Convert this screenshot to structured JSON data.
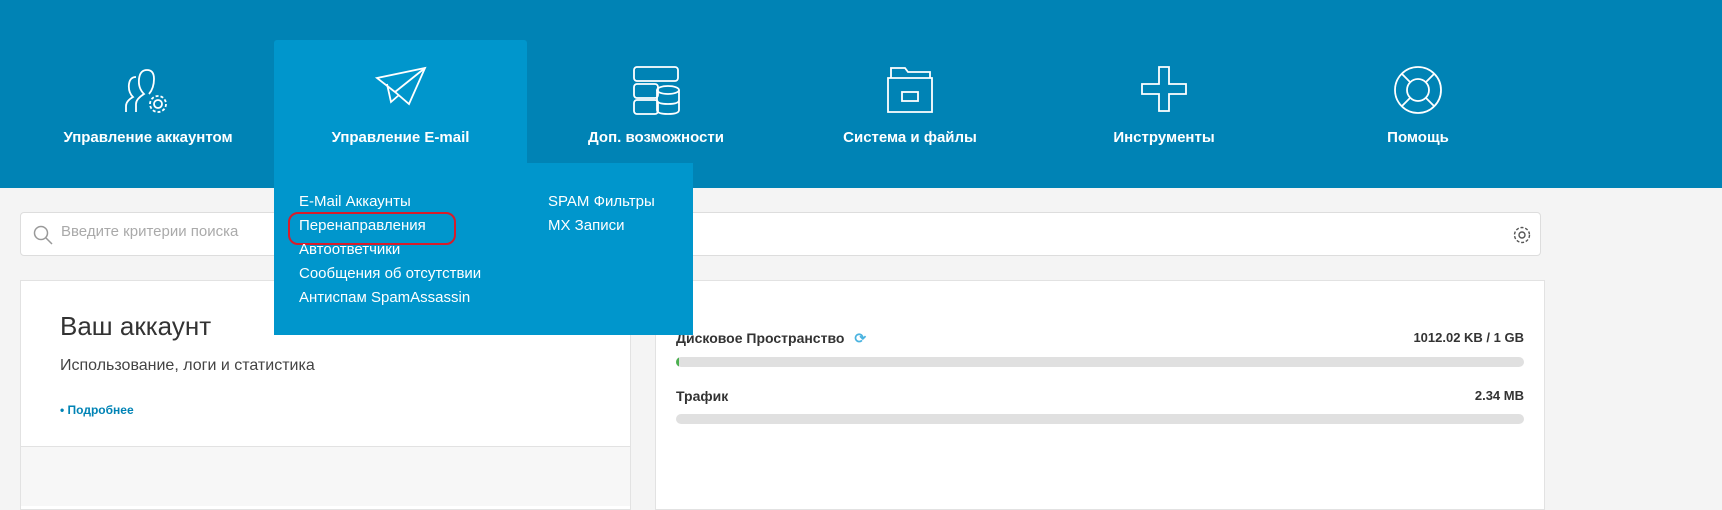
{
  "nav": [
    {
      "label": "Управление аккаунтом",
      "icon": "users-gear-icon"
    },
    {
      "label": "Управление E-mail",
      "icon": "paper-plane-icon"
    },
    {
      "label": "Доп. возможности",
      "icon": "server-database-icon"
    },
    {
      "label": "Система и файлы",
      "icon": "folder-icon"
    },
    {
      "label": "Инструменты",
      "icon": "plus-icon"
    },
    {
      "label": "Помощь",
      "icon": "lifebuoy-icon"
    }
  ],
  "email_menu": {
    "col1": [
      "E-Mail Аккаунты",
      "Перенаправления",
      "Автоответчики",
      "Сообщения об отсутствии",
      "Антиспам SpamAssassin"
    ],
    "col2": [
      "SPAM Фильтры",
      "MX Записи"
    ],
    "highlighted": "Перенаправления"
  },
  "search": {
    "placeholder": "Введите критерии поиска"
  },
  "account": {
    "title": "Ваш аккаунт",
    "subtitle": "Использование, логи и статистика",
    "more": "• Подробнее"
  },
  "usage": {
    "disk": {
      "label": "Дисковое Пространство",
      "value": "1012.02 KB / 1 GB",
      "fraction": 0.001
    },
    "traffic": {
      "label": "Трафик",
      "value": "2.34 MB",
      "fraction": 0
    }
  }
}
